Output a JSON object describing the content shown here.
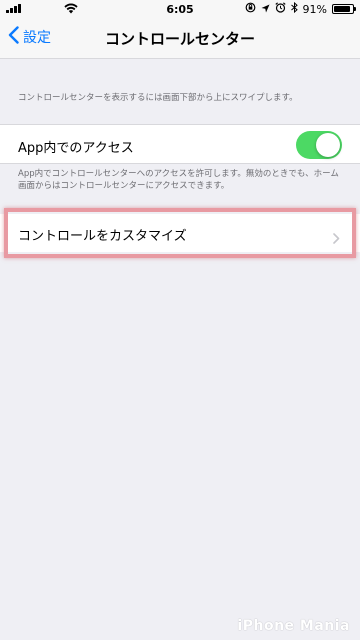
{
  "status_bar": {
    "time": "6:05",
    "battery": "91%",
    "battery_level": 0.91
  },
  "nav": {
    "back_label": "設定",
    "title": "コントロールセンター"
  },
  "settings": {
    "hint_top": "コントロールセンターを表示するには画面下部から上にスワイプします。",
    "access_label": "App内でのアクセス",
    "access_enabled": true,
    "access_hint": "App内でコントロールセンターへのアクセスを許可します。無効のときでも、ホーム画面からはコントロールセンターにアクセスできます。",
    "customize_label": "コントロールをカスタマイズ"
  },
  "watermark": "iPhone Mania",
  "colors": {
    "accent": "#0a7aff",
    "toggle_on": "#4cd964",
    "highlight": "#e89aa2",
    "background": "#efeff4"
  }
}
